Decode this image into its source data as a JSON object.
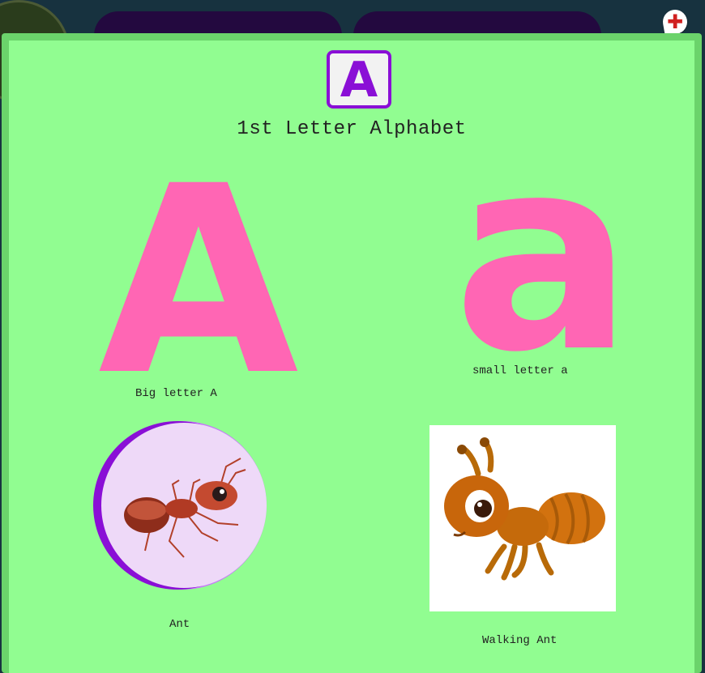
{
  "modal": {
    "letter_icon": "A",
    "title": "1st Letter Alphabet",
    "big_letter": "A",
    "small_letter": "a",
    "big_caption": "Big letter A",
    "small_caption": "small letter a",
    "ant_caption": "Ant",
    "walking_ant_caption": "Walking Ant"
  },
  "icons": {
    "add": "plus-icon",
    "ant": "ant-icon",
    "walking_ant": "walking-ant-icon"
  },
  "colors": {
    "modal_bg": "#91fd91",
    "modal_border": "#6bd36b",
    "letter_pink": "#ff66b4",
    "accent_purple": "#8a0fd6"
  }
}
